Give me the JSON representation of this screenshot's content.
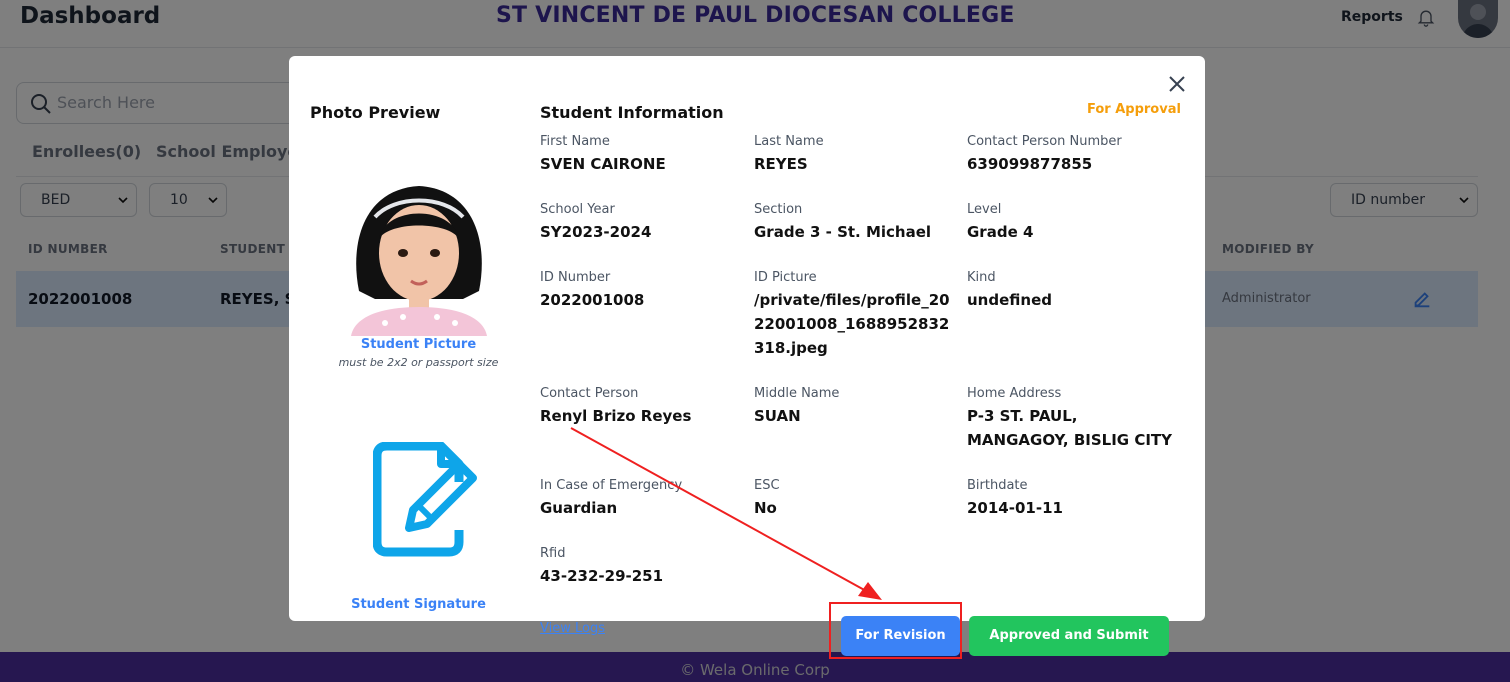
{
  "header": {
    "title": "Dashboard",
    "institution": "ST VINCENT DE PAUL DIOCESAN COLLEGE",
    "reports_label": "Reports"
  },
  "search": {
    "placeholder": "Search Here"
  },
  "tabs": [
    {
      "label": "Enrollees(0)"
    },
    {
      "label": "School Employees"
    }
  ],
  "filters": {
    "department": "BED",
    "page_size": "10",
    "sort_by": "ID number"
  },
  "table": {
    "columns": [
      "ID NUMBER",
      "STUDENT N",
      "MODIFIED BY"
    ],
    "rows": [
      {
        "id_number": "2022001008",
        "student_name": "REYES, SV",
        "modified_by": "Administrator"
      }
    ]
  },
  "footer": {
    "text": "© Wela Online Corp"
  },
  "modal": {
    "photo_preview_title": "Photo Preview",
    "student_picture_label": "Student Picture",
    "student_picture_note": "must be 2x2 or passport size",
    "student_signature_label": "Student Signature",
    "info_title": "Student Information",
    "status": "For Approval",
    "fields": {
      "first_name": {
        "label": "First Name",
        "value": "SVEN CAIRONE"
      },
      "last_name": {
        "label": "Last Name",
        "value": "REYES"
      },
      "contact_person_number": {
        "label": "Contact Person Number",
        "value": "639099877855"
      },
      "school_year": {
        "label": "School Year",
        "value": "SY2023-2024"
      },
      "section": {
        "label": "Section",
        "value": "Grade 3 - St. Michael"
      },
      "level": {
        "label": "Level",
        "value": "Grade 4"
      },
      "id_number": {
        "label": "ID Number",
        "value": "2022001008"
      },
      "id_picture": {
        "label": "ID Picture",
        "value": "/private/files/profile_2022001008_1688952832318.jpeg"
      },
      "kind": {
        "label": "Kind",
        "value": "undefined"
      },
      "contact_person": {
        "label": "Contact Person",
        "value": "Renyl Brizo Reyes"
      },
      "middle_name": {
        "label": "Middle Name",
        "value": "SUAN"
      },
      "home_address": {
        "label": "Home Address",
        "value": "P-3 ST. PAUL, MANGAGOY, BISLIG CITY"
      },
      "emergency": {
        "label": "In Case of Emergency",
        "value": "Guardian"
      },
      "esc": {
        "label": "ESC",
        "value": "No"
      },
      "birthdate": {
        "label": "Birthdate",
        "value": "2014-01-11"
      },
      "rfid": {
        "label": "Rfid",
        "value": "43-232-29-251"
      }
    },
    "view_logs_label": "View Logs",
    "revision_button": "For Revision",
    "approve_button": "Approved and Submit"
  },
  "colors": {
    "brand_purple": "#4c2fa0",
    "primary_blue": "#3b82f6",
    "approve_green": "#22c55e",
    "status_orange": "#f59e0b",
    "annotation_red": "#ef2020"
  },
  "icons": [
    "bell-icon",
    "search-icon",
    "chevron-down-icon",
    "edit-icon",
    "close-icon",
    "signature-icon"
  ]
}
